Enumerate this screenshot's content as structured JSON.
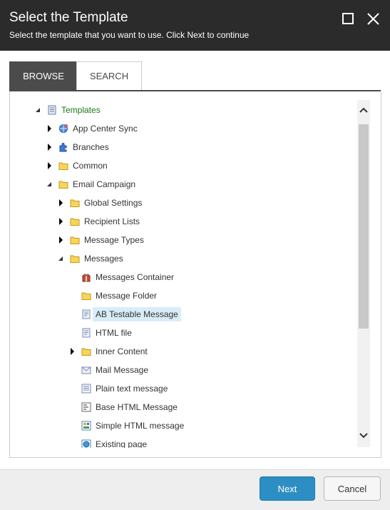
{
  "dialog": {
    "title": "Select the Template",
    "subtitle": "Select the template that you want to use. Click Next to continue"
  },
  "tabs": [
    {
      "label": "BROWSE",
      "active": true
    },
    {
      "label": "SEARCH",
      "active": false
    }
  ],
  "tree": [
    {
      "label": "Templates",
      "icon": "template-icon",
      "state": "expanded",
      "level": 0,
      "color": "#1a7a1a"
    },
    {
      "label": "App Center Sync",
      "icon": "globe-sync-icon",
      "state": "collapsed",
      "level": 1
    },
    {
      "label": "Branches",
      "icon": "puzzle-icon",
      "state": "collapsed",
      "level": 1
    },
    {
      "label": "Common",
      "icon": "folder-icon",
      "state": "collapsed",
      "level": 1
    },
    {
      "label": "Email Campaign",
      "icon": "folder-icon",
      "state": "expanded",
      "level": 1
    },
    {
      "label": "Global Settings",
      "icon": "folder-icon",
      "state": "collapsed",
      "level": 2
    },
    {
      "label": "Recipient Lists",
      "icon": "folder-icon",
      "state": "collapsed",
      "level": 2
    },
    {
      "label": "Message Types",
      "icon": "folder-icon",
      "state": "collapsed",
      "level": 2
    },
    {
      "label": "Messages",
      "icon": "folder-icon",
      "state": "expanded",
      "level": 2
    },
    {
      "label": "Messages Container",
      "icon": "gift-box-icon",
      "state": "leaf",
      "level": 3
    },
    {
      "label": "Message Folder",
      "icon": "folder-icon",
      "state": "leaf",
      "level": 3
    },
    {
      "label": "AB Testable Message",
      "icon": "document-icon",
      "state": "leaf",
      "level": 3,
      "selected": true
    },
    {
      "label": "HTML file",
      "icon": "document-icon",
      "state": "leaf",
      "level": 3
    },
    {
      "label": "Inner Content",
      "icon": "folder-icon",
      "state": "collapsed",
      "level": 3
    },
    {
      "label": "Mail Message",
      "icon": "envelope-icon",
      "state": "leaf",
      "level": 3
    },
    {
      "label": "Plain text message",
      "icon": "text-document-icon",
      "state": "leaf",
      "level": 3
    },
    {
      "label": "Base HTML Message",
      "icon": "html-document-icon",
      "state": "leaf",
      "level": 3
    },
    {
      "label": "Simple HTML message",
      "icon": "layout-document-icon",
      "state": "leaf",
      "level": 3
    },
    {
      "label": "Existing page",
      "icon": "globe-page-icon",
      "state": "leaf",
      "level": 3
    }
  ],
  "buttons": {
    "next": "Next",
    "cancel": "Cancel"
  },
  "colors": {
    "header_bg": "#2b2b2b",
    "primary_button": "#2d8ec4",
    "selection": "#d9edf7",
    "root_label": "#1a7a1a"
  }
}
